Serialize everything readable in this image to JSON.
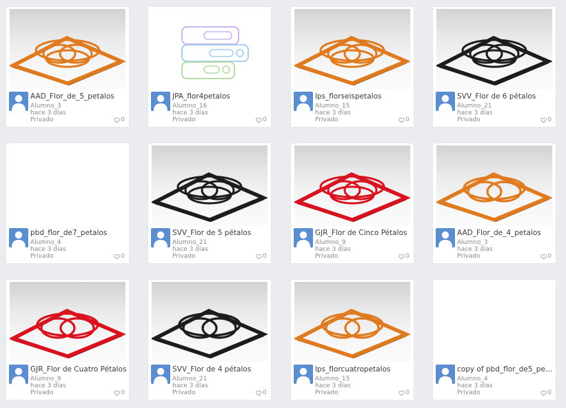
{
  "cards": [
    {
      "title": "AAD_Flor_de_5_petalos",
      "author": "Alumno_3",
      "time": "hace 3 días",
      "visibility": "Privado",
      "likes": "0",
      "thumb": "coaster",
      "color": "#e07a1f",
      "petals": 3
    },
    {
      "title": "JPA_flor4petalos",
      "author": "Alumno_16",
      "time": "hace 3 días",
      "visibility": "Privado",
      "likes": "0",
      "thumb": "blocks"
    },
    {
      "title": "lps_florseispetalos",
      "author": "Alumno_15",
      "time": "hace 3 días",
      "visibility": "Privado",
      "likes": "0",
      "thumb": "coaster",
      "color": "#e07a1f",
      "petals": 3
    },
    {
      "title": "SVV_Flor de 6 pétalos",
      "author": "Alumno_21",
      "time": "hace 3 días",
      "visibility": "Privado",
      "likes": "0",
      "thumb": "coaster",
      "color": "#1c1c1c",
      "petals": 3
    },
    {
      "title": "pbd_flor_de7_petalos",
      "author": "Alumno_4",
      "time": "hace 3 días",
      "visibility": "Privado",
      "likes": "0",
      "thumb": "blank"
    },
    {
      "title": "SVV_Flor de 5 pétalos",
      "author": "Alumno_21",
      "time": "hace 3 días",
      "visibility": "Privado",
      "likes": "0",
      "thumb": "coaster",
      "color": "#1c1c1c",
      "petals": 3
    },
    {
      "title": "GJR_Flor de Cinco Pétalos",
      "author": "Alumno_9",
      "time": "hace 3 días",
      "visibility": "Privado",
      "likes": "0",
      "thumb": "coaster",
      "color": "#d8121e",
      "petals": 3
    },
    {
      "title": "AAD_Flor_de_4_petalos",
      "author": "Alumno_3",
      "time": "hace 3 días",
      "visibility": "Privado",
      "likes": "0",
      "thumb": "coaster",
      "color": "#e07a1f",
      "petals": 2
    },
    {
      "title": "GJR_Flor de Cuatro Pétalos",
      "author": "Alumno_9",
      "time": "hace 3 días",
      "visibility": "Privado",
      "likes": "0",
      "thumb": "coaster",
      "color": "#d8121e",
      "petals": 2
    },
    {
      "title": "SVV_Flor de 4 pétalos",
      "author": "Alumno_21",
      "time": "hace 3 días",
      "visibility": "Privado",
      "likes": "0",
      "thumb": "coaster",
      "color": "#1c1c1c",
      "petals": 2
    },
    {
      "title": "lps_florcuatropetalos",
      "author": "Alumno_15",
      "time": "hace 3 días",
      "visibility": "Privado",
      "likes": "0",
      "thumb": "coaster",
      "color": "#e07a1f",
      "petals": 2
    },
    {
      "title": "copy of pbd_flor_de5_pet...",
      "author": "Alumno_4",
      "time": "hace 3 días",
      "visibility": "Privado",
      "likes": "0",
      "thumb": "blank"
    }
  ]
}
